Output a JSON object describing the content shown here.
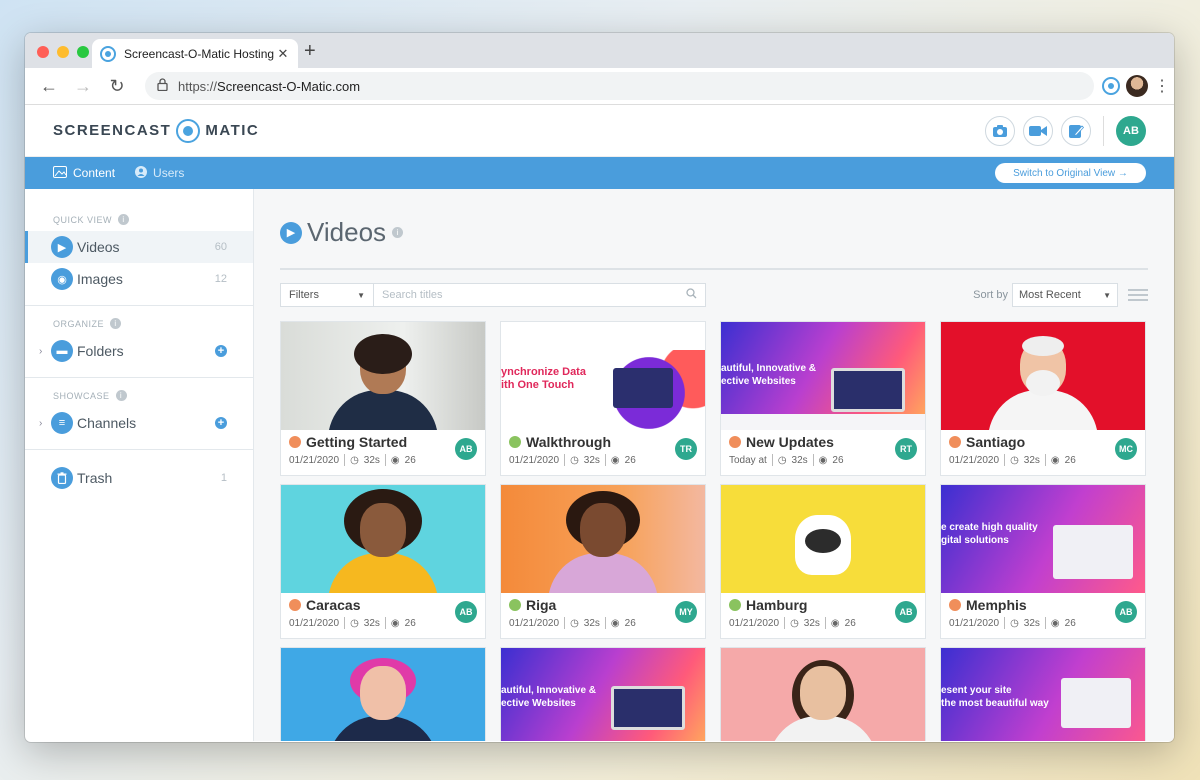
{
  "browser": {
    "tab_title": "Screencast-O-Matic Hosting",
    "tab_close": "✕",
    "new_tab": "+",
    "url_proto": "https://",
    "url_host": "Screencast-O-Matic.com",
    "traffic_light_colors": [
      "#ff5f57",
      "#febc2e",
      "#28c840"
    ]
  },
  "app": {
    "logo_left": "SCREENCAST",
    "logo_right": "MATIC",
    "user_initials": "AB",
    "accent_color": "#4a9ddc",
    "avatar_color": "#2ea88f"
  },
  "nav": {
    "content": "Content",
    "users": "Users",
    "switch_view": "Switch to Original View →"
  },
  "sidebar": {
    "quick_view": "QUICK VIEW",
    "organize": "ORGANIZE",
    "showcase": "SHOWCASE",
    "items": {
      "videos": {
        "label": "Videos",
        "count": "60"
      },
      "images": {
        "label": "Images",
        "count": "12"
      },
      "folders": {
        "label": "Folders"
      },
      "channels": {
        "label": "Channels"
      },
      "trash": {
        "label": "Trash",
        "count": "1"
      }
    }
  },
  "main": {
    "title": "Videos",
    "filters_label": "Filters",
    "search_placeholder": "Search titles",
    "sort_by": "Sort by",
    "sort_value": "Most Recent"
  },
  "cards": [
    {
      "title": "Getting Started",
      "date": "01/21/2020",
      "duration": "32s",
      "views": "26",
      "initials": "AB",
      "status": "orange"
    },
    {
      "title": "Walkthrough",
      "date": "01/21/2020",
      "duration": "32s",
      "views": "26",
      "initials": "TR",
      "status": "green"
    },
    {
      "title": "New Updates",
      "date": "Today at",
      "duration": "32s",
      "views": "26",
      "initials": "RT",
      "status": "orange"
    },
    {
      "title": "Santiago",
      "date": "01/21/2020",
      "duration": "32s",
      "views": "26",
      "initials": "MC",
      "status": "orange"
    },
    {
      "title": "Caracas",
      "date": "01/21/2020",
      "duration": "32s",
      "views": "26",
      "initials": "AB",
      "status": "orange"
    },
    {
      "title": "Riga",
      "date": "01/21/2020",
      "duration": "32s",
      "views": "26",
      "initials": "MY",
      "status": "green"
    },
    {
      "title": "Hamburg",
      "date": "01/21/2020",
      "duration": "32s",
      "views": "26",
      "initials": "AB",
      "status": "green"
    },
    {
      "title": "Memphis",
      "date": "01/21/2020",
      "duration": "32s",
      "views": "26",
      "initials": "AB",
      "status": "orange"
    }
  ],
  "thumb_text": {
    "walkthrough": "ynchronize Data\nith One Touch",
    "new_updates": "autiful, Innovative &\nective Websites",
    "memphis": "e create high quality\ngital solutions",
    "row3_b": "autiful, Innovative &\nective Websites",
    "row3_d": "esent your site\nthe most beautiful way"
  }
}
